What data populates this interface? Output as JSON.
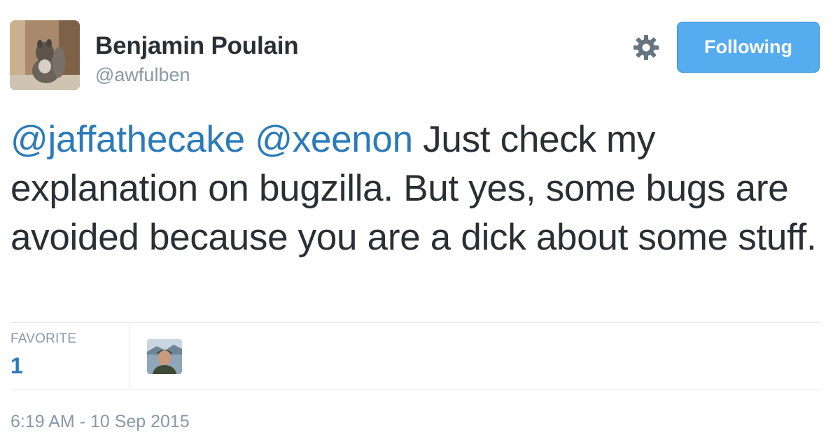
{
  "author": {
    "name": "Benjamin Poulain",
    "handle": "@awfulben",
    "avatar_icon": "squirrel-avatar"
  },
  "actions": {
    "settings_icon": "gear-icon",
    "follow_label": "Following"
  },
  "tweet": {
    "mention1": "@jaffathecake",
    "mention2": "@xeenon",
    "body": " Just check my explanation on bugzilla. But yes, some bugs are avoided because you are a dick about some stuff."
  },
  "stats": {
    "favorite_label": "FAVORITE",
    "favorite_count": "1",
    "favoriter_avatar_icon": "user-avatar"
  },
  "timestamp": "6:19 AM - 10 Sep 2015",
  "colors": {
    "link": "#2b7bb9",
    "button": "#55acee",
    "muted": "#8899a6",
    "text": "#292f33"
  }
}
